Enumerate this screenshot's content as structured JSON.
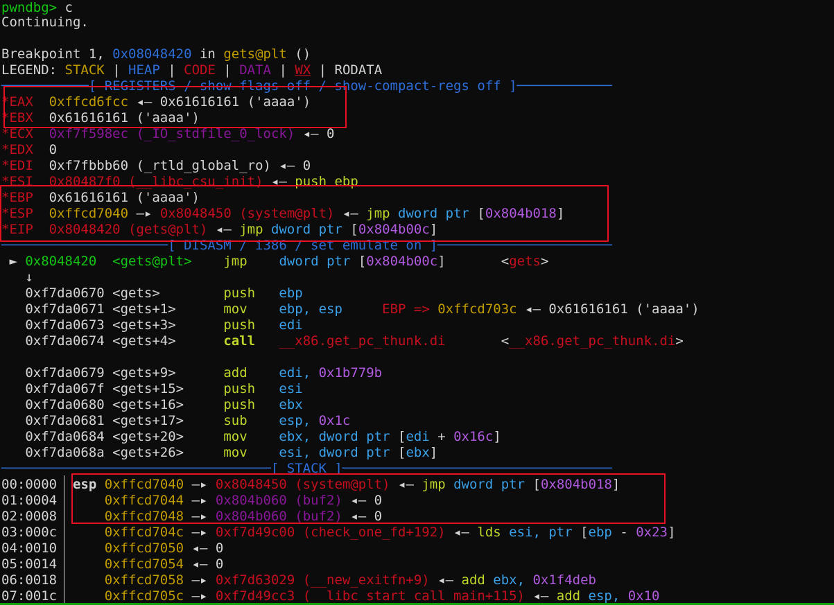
{
  "prompt": "pwndbg> ",
  "command": "c",
  "continuing": "Continuing.",
  "breakpoint": {
    "prefix": "Breakpoint 1, ",
    "addr": "0x08048420",
    "mid": " in ",
    "func": "gets@plt",
    "suffix": " ()"
  },
  "legend": {
    "label": "LEGEND: ",
    "stack": "STACK",
    "heap": "HEAP",
    "code": "CODE",
    "data": "DATA",
    "wx": "WX",
    "rodata": "RODATA",
    "sep": " | "
  },
  "headers": {
    "registers": "───────────[ REGISTERS / show-flags off / show-compact-regs off ]────────────",
    "disasm": "─────────────────────[ DISASM / i386 / set emulate on ]──────────────────────",
    "stack": "──────────────────────────────────[ STACK ]──────────────────────────────────"
  },
  "registers": {
    "eax": {
      "name": "*EAX",
      "val": "0xffcd6fcc",
      "rest": " ◂— 0x61616161 ('aaaa')"
    },
    "ebx": {
      "name": "*EBX",
      "val": "0x61616161 ('aaaa')"
    },
    "ecx": {
      "name": "*ECX",
      "val": "0xf7f598ec (_IO_stdfile_0_lock)",
      "rest": " ◂— 0"
    },
    "edx": {
      "name": "*EDX",
      "val": "0"
    },
    "edi": {
      "name": "*EDI",
      "val": "0xf7fbbb60 (_rtld_global_ro) ◂— 0"
    },
    "esi": {
      "name": "*ESI",
      "val": "0x80487f0 (__libc_csu_init)",
      "arrow": " ◂— ",
      "ins": "push ebp"
    },
    "ebp": {
      "name": "*EBP",
      "val": "0x61616161 ('aaaa')"
    },
    "esp": {
      "name": "*ESP",
      "val": "0xffcd7040",
      "arrow": " —▸ ",
      "target": "0x8048450 (system@plt)",
      "arrow2": " ◂— ",
      "ins": "jmp",
      "ptr": " dword ptr ",
      "lb": "[",
      "addr": "0x804b018",
      "rb": "]"
    },
    "eip": {
      "name": "*EIP",
      "val": "0x8048420 (gets@plt)",
      "arrow": " ◂— ",
      "ins": "jmp",
      "ptr": " dword ptr ",
      "lb": "[",
      "addr": "0x804b00c",
      "rb": "]"
    }
  },
  "disasm": {
    "l0": {
      "mark": " ► ",
      "addr": "0x8048420",
      "sym": " <gets@plt>",
      "op": "jmp",
      "arg": "dword ptr [0x804b00c]",
      "argaddr": "0x804b00c",
      "ann": "<gets>"
    },
    "l1": {
      "mark": "   ↓"
    },
    "l2": {
      "addr": "0xf7da0670",
      "sym": " <gets>",
      "op": "push",
      "arg": "ebp"
    },
    "l3": {
      "addr": "0xf7da0671",
      "sym": " <gets+1>",
      "op": "mov",
      "arg": "ebp, esp",
      "ann1": "EBP => ",
      "ann2": "0xffcd703c",
      "ann3": " ◂— 0x61616161 ('aaaa')"
    },
    "l4": {
      "addr": "0xf7da0673",
      "sym": " <gets+3>",
      "op": "push",
      "arg": "edi"
    },
    "l5": {
      "addr": "0xf7da0674",
      "sym": " <gets+4>",
      "op": "call",
      "arg": "__x86.get_pc_thunk.di",
      "ann": "<__x86.get_pc_thunk.di>"
    },
    "l6": {
      "addr": "0xf7da0679",
      "sym": " <gets+9>",
      "op": "add",
      "arg": "edi, ",
      "num": "0x1b779b"
    },
    "l7": {
      "addr": "0xf7da067f",
      "sym": " <gets+15>",
      "op": "push",
      "arg": "esi"
    },
    "l8": {
      "addr": "0xf7da0680",
      "sym": " <gets+16>",
      "op": "push",
      "arg": "ebx"
    },
    "l9": {
      "addr": "0xf7da0681",
      "sym": " <gets+17>",
      "op": "sub",
      "arg": "esp, ",
      "num": "0x1c"
    },
    "l10": {
      "addr": "0xf7da0684",
      "sym": " <gets+20>",
      "op": "mov",
      "arg": "ebx, dword ptr [edi + ",
      "num": "0x16c",
      "end": "]"
    },
    "l11": {
      "addr": "0xf7da068a",
      "sym": " <gets+26>",
      "op": "mov",
      "arg": "esi, dword ptr [ebx]"
    }
  },
  "stack": [
    {
      "idx": "00:0000",
      "reg": "esp",
      "addr": "0xffcd7040",
      "arrow": " —▸ ",
      "tgt": "0x8048450 (system@plt)",
      "tgt_color": "red",
      "rest": " ◂— ",
      "ins": "jmp",
      "ptr": " dword ptr ",
      "lb": "[",
      "num": "0x804b018",
      "rb": "]"
    },
    {
      "idx": "01:0004",
      "reg": "",
      "addr": "0xffcd7044",
      "arrow": " —▸ ",
      "tgt": "0x804b060 (buf2)",
      "tgt_color": "purple",
      "rest": " ◂— 0"
    },
    {
      "idx": "02:0008",
      "reg": "",
      "addr": "0xffcd7048",
      "arrow": " —▸ ",
      "tgt": "0x804b060 (buf2)",
      "tgt_color": "purple",
      "rest": " ◂— 0"
    },
    {
      "idx": "03:000c",
      "reg": "",
      "addr": "0xffcd704c",
      "arrow": " —▸ ",
      "tgt": "0xf7d49c00 (check_one_fd+192)",
      "tgt_color": "red",
      "rest": " ◂— ",
      "ins": "lds",
      "ptr": " esi, ptr ",
      "lb": "[",
      "reg2": "ebp",
      "minus": " - ",
      "num": "0x23",
      "rb": "]"
    },
    {
      "idx": "04:0010",
      "reg": "",
      "addr": "0xffcd7050",
      "arrow": "",
      "tgt": "",
      "rest": " ◂— 0"
    },
    {
      "idx": "05:0014",
      "reg": "",
      "addr": "0xffcd7054",
      "arrow": "",
      "tgt": "",
      "rest": " ◂— 0"
    },
    {
      "idx": "06:0018",
      "reg": "",
      "addr": "0xffcd7058",
      "arrow": " —▸ ",
      "tgt": "0xf7d63029 (__new_exitfn+9)",
      "tgt_color": "red",
      "rest": " ◂— ",
      "ins": "add",
      "ptr": " ebx, ",
      "num": "0x1f4deb"
    },
    {
      "idx": "07:001c",
      "reg": "",
      "addr": "0xffcd705c",
      "arrow": " —▸ ",
      "tgt": "0xf7d49cc3 (__libc_start_call_main+115)",
      "tgt_color": "red",
      "rest": " ◂— ",
      "ins": "add",
      "ptr": " esp, ",
      "num": "0x10"
    }
  ]
}
